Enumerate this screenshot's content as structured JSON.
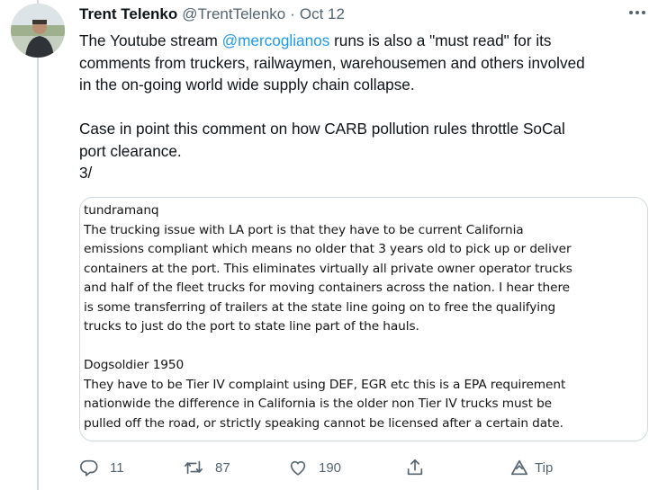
{
  "tweet": {
    "author_name": "Trent Telenko",
    "handle": "@TrentTelenko",
    "separator": "·",
    "date": "Oct 12",
    "text_before_mention": "The Youtube stream ",
    "mention": "@mercoglianos",
    "text_line1_after_mention": " runs is also a \"must read\" for its",
    "text_line2": "comments from truckers, railwaymen, warehousemen and others involved",
    "text_line3": "in the on-going world wide supply chain collapse.",
    "text_line4": "Case in point this comment on how CARB pollution  rules throttle SoCal",
    "text_line5": "port clearance.",
    "text_line6": "3/"
  },
  "media": {
    "lines": [
      "tundramanq",
      "The trucking issue with LA port is that they have to be current California",
      "emissions compliant which means no older that 3 years old to pick up or deliver",
      "containers at the port. This eliminates virtually all private owner operator trucks",
      "and half of the fleet trucks for moving containers across the nation. I hear there",
      "is some transferring of trailers at the state line going on to free the qualifying",
      "trucks to just do the port to state line part of the hauls.",
      "",
      "Dogsoldier 1950",
      "They have to be Tier IV complaint using DEF, EGR etc this is a EPA requirement",
      "nationwide the difference in California is the older non Tier IV trucks must be",
      "pulled off the road, or strictly speaking cannot be licensed after a certain date."
    ]
  },
  "actions": {
    "reply_count": "11",
    "retweet_count": "87",
    "like_count": "190",
    "tip_label": "Tip"
  },
  "icons": {
    "avatar": "avatar",
    "more": "more-icon",
    "reply": "reply-icon",
    "retweet": "retweet-icon",
    "like": "heart-icon",
    "share": "share-icon",
    "tip": "tip-icon"
  },
  "colors": {
    "text": "#0f1419",
    "secondary": "#536471",
    "link": "#1d9bf0",
    "border": "#cfd9de"
  }
}
